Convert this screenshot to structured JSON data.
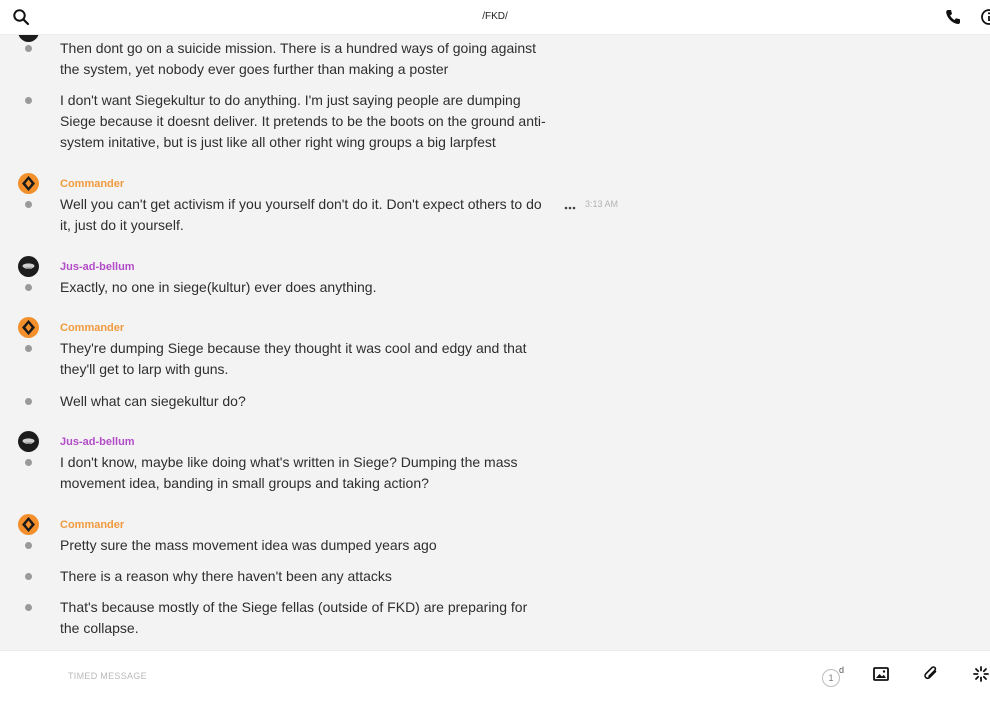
{
  "header": {
    "title": "/FKD/"
  },
  "authors": {
    "commander": "Commander",
    "jus": "Jus-ad-bellum"
  },
  "messages": [
    {
      "text": "Then dont go on a suicide mission. There is a hundred ways of going against the system, yet nobody ever goes further than making a poster"
    },
    {
      "text": "I don't want Siegekultur to do anything. I'm just saying people are dumping Siege because it doesnt deliver. It pretends to be the boots on the ground anti-system initative, but is just like all other right wing groups a big larpfest"
    },
    {
      "text": "Well you can't get activism if you yourself don't do it. Don't expect others to do it, just do it yourself."
    },
    {
      "text": "Exactly, no one in siege(kultur) ever does anything."
    },
    {
      "text": "They're dumping Siege because they thought it was cool and edgy and that they'll get to larp with guns."
    },
    {
      "text": "Well what can siegekultur do?"
    },
    {
      "text": "I don't know, maybe like doing what's written in Siege? Dumping the mass movement idea, banding in small groups and taking action?"
    },
    {
      "text": "Pretty sure the mass movement idea was dumped years ago"
    },
    {
      "text": "There is a reason why there haven't been any attacks"
    },
    {
      "text": "That's because mostly of the Siege fellas (outside of FKD) are preparing for the collapse."
    }
  ],
  "timestamp": "3:13 AM",
  "composer": {
    "placeholder": "TIMED MESSAGE",
    "timer_value": "1",
    "timer_unit": "d"
  },
  "colors": {
    "commander_name": "#f09a3d",
    "jus_name": "#b34cc8",
    "background": "#f3f3f3"
  },
  "icons": [
    "search-icon",
    "phone-icon",
    "info-icon",
    "more-icon",
    "image-icon",
    "paperclip-icon",
    "sparkle-icon",
    "timer-icon"
  ]
}
